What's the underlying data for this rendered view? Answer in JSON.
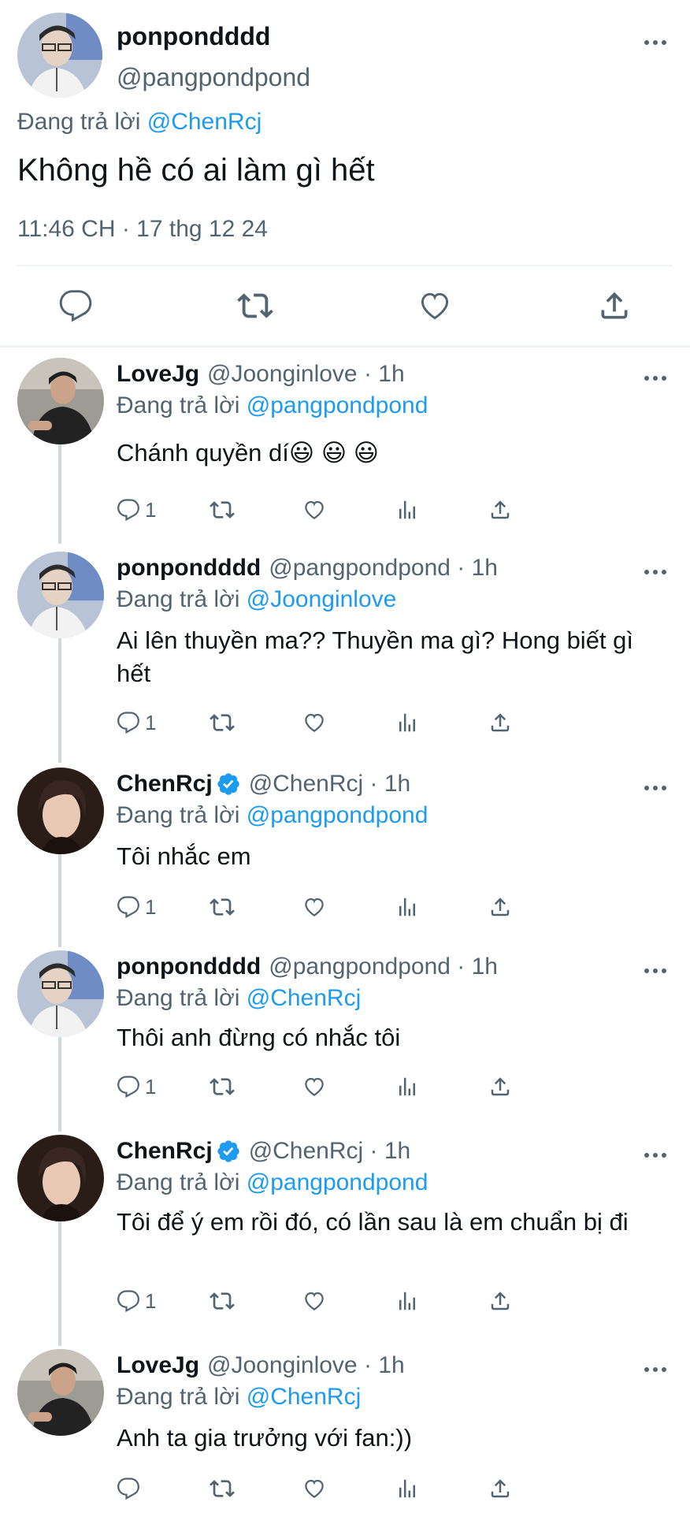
{
  "main_tweet": {
    "name": "ponpondddd",
    "handle": "@pangpondpond",
    "reply_prefix": "Đang trả lời ",
    "reply_mention": "@ChenRcj",
    "text": "Không hề có ai làm gì hết",
    "timestamp": "11:46 CH · 17 thg 12 24",
    "icons": [
      "more-icon",
      "reply-icon",
      "retweet-icon",
      "like-icon",
      "share-icon"
    ]
  },
  "replies": [
    {
      "name": "LoveJg",
      "handle": "@Joonginlove · 1h",
      "verified": false,
      "reply_prefix": "Đang trả lời ",
      "reply_mention": "@pangpondpond",
      "text": "Chánh quyền dí😃 😃 😃",
      "reply_count": "1"
    },
    {
      "name": "ponpondddd",
      "handle": "@pangpondpond · 1h",
      "verified": false,
      "reply_prefix": "Đang trả lời ",
      "reply_mention": "@Joonginlove",
      "text": "Ai lên thuyền ma?? Thuyền ma gì? Hong biết gì hết",
      "reply_count": "1"
    },
    {
      "name": "ChenRcj",
      "handle": "@ChenRcj · 1h",
      "verified": true,
      "reply_prefix": "Đang trả lời ",
      "reply_mention": "@pangpondpond",
      "text": "Tôi nhắc em",
      "reply_count": "1"
    },
    {
      "name": "ponpondddd",
      "handle": "@pangpondpond · 1h",
      "verified": false,
      "reply_prefix": "Đang trả lời ",
      "reply_mention": "@ChenRcj",
      "text": "Thôi anh đừng có nhắc tôi",
      "reply_count": "1"
    },
    {
      "name": "ChenRcj",
      "handle": "@ChenRcj · 1h",
      "verified": true,
      "reply_prefix": "Đang trả lời ",
      "reply_mention": "@pangpondpond",
      "text": "Tôi để ý em rồi đó, có lần sau là em chuẩn bị đi",
      "reply_count": "1"
    },
    {
      "name": "LoveJg",
      "handle": "@Joonginlove · 1h",
      "verified": false,
      "reply_prefix": "Đang trả lời ",
      "reply_mention": "@ChenRcj",
      "text": "Anh ta gia trưởng với fan:))",
      "reply_count": ""
    }
  ],
  "colors": {
    "text": "#0f1419",
    "secondary": "#536471",
    "link": "#1d9bf0",
    "divider": "#eff3f4",
    "thread_line": "#cfd9de",
    "verified": "#1d9bf0"
  }
}
